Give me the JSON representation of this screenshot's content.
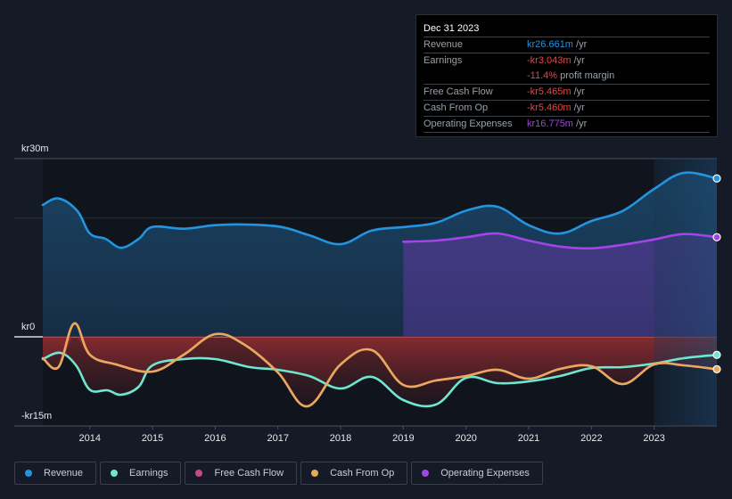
{
  "tooltip": {
    "date": "Dec 31 2023",
    "rows": [
      {
        "label": "Revenue",
        "value": "kr26.661m",
        "unit": " /yr",
        "color": "#2394df"
      },
      {
        "label": "Earnings",
        "value": "-kr3.043m",
        "unit": " /yr",
        "color": "#e84545"
      },
      {
        "label": "",
        "value": "-11.4%",
        "unit": " profit margin",
        "color": "#e84545"
      },
      {
        "label": "Free Cash Flow",
        "value": "-kr5.465m",
        "unit": " /yr",
        "color": "#e84545"
      },
      {
        "label": "Cash From Op",
        "value": "-kr5.460m",
        "unit": " /yr",
        "color": "#e84545"
      },
      {
        "label": "Operating Expenses",
        "value": "kr16.775m",
        "unit": " /yr",
        "color": "#a145e8"
      }
    ]
  },
  "legend": [
    {
      "label": "Revenue",
      "color": "#2394df"
    },
    {
      "label": "Earnings",
      "color": "#6ee6d0"
    },
    {
      "label": "Free Cash Flow",
      "color": "#c54a8a"
    },
    {
      "label": "Cash From Op",
      "color": "#e8a95c"
    },
    {
      "label": "Operating Expenses",
      "color": "#a145e8"
    }
  ],
  "chart_data": {
    "type": "line",
    "title": "",
    "xlabel": "",
    "ylabel": "",
    "currency": "kr",
    "y_tick_labels": [
      "kr30m",
      "kr0",
      "-kr15m"
    ],
    "ylim": [
      -15,
      30
    ],
    "xlim": [
      2013.25,
      2024.0
    ],
    "x_tick_labels": [
      "2014",
      "2015",
      "2016",
      "2017",
      "2018",
      "2019",
      "2020",
      "2021",
      "2022",
      "2023"
    ],
    "x_ticks": [
      2014,
      2015,
      2016,
      2017,
      2018,
      2019,
      2020,
      2021,
      2022,
      2023
    ],
    "gridlines": [
      30,
      20,
      0,
      -15
    ],
    "highlight_start": 2023.0,
    "series": [
      {
        "name": "Revenue",
        "color": "#2394df",
        "fill": true,
        "points": [
          [
            2013.25,
            22.2
          ],
          [
            2013.5,
            23.3
          ],
          [
            2013.8,
            21.2
          ],
          [
            2014.0,
            17.4
          ],
          [
            2014.25,
            16.5
          ],
          [
            2014.5,
            15.0
          ],
          [
            2014.78,
            16.5
          ],
          [
            2015.0,
            18.5
          ],
          [
            2015.5,
            18.2
          ],
          [
            2016.0,
            18.8
          ],
          [
            2016.5,
            18.9
          ],
          [
            2017.05,
            18.5
          ],
          [
            2017.5,
            17.1
          ],
          [
            2018.0,
            15.6
          ],
          [
            2018.5,
            17.9
          ],
          [
            2019.03,
            18.5
          ],
          [
            2019.52,
            19.2
          ],
          [
            2020.02,
            21.3
          ],
          [
            2020.5,
            21.9
          ],
          [
            2021.0,
            18.8
          ],
          [
            2021.5,
            17.4
          ],
          [
            2022.0,
            19.5
          ],
          [
            2022.5,
            21.2
          ],
          [
            2023.0,
            24.9
          ],
          [
            2023.47,
            27.6
          ],
          [
            2024.0,
            26.661
          ]
        ]
      },
      {
        "name": "Operating Expenses",
        "color": "#a145e8",
        "fill": true,
        "points": [
          [
            2019.0,
            16.0
          ],
          [
            2019.52,
            16.2
          ],
          [
            2020.02,
            16.8
          ],
          [
            2020.5,
            17.4
          ],
          [
            2021.0,
            16.2
          ],
          [
            2021.5,
            15.2
          ],
          [
            2022.0,
            14.9
          ],
          [
            2022.5,
            15.5
          ],
          [
            2023.0,
            16.4
          ],
          [
            2023.47,
            17.3
          ],
          [
            2024.0,
            16.775
          ]
        ]
      },
      {
        "name": "Earnings",
        "color": "#6ee6d0",
        "fill": false,
        "points": [
          [
            2013.25,
            -3.75
          ],
          [
            2013.53,
            -2.7
          ],
          [
            2013.78,
            -4.8
          ],
          [
            2014.0,
            -8.9
          ],
          [
            2014.28,
            -9.0
          ],
          [
            2014.5,
            -9.75
          ],
          [
            2014.78,
            -8.4
          ],
          [
            2015.0,
            -4.8
          ],
          [
            2015.5,
            -3.75
          ],
          [
            2016.0,
            -3.75
          ],
          [
            2016.55,
            -5.1
          ],
          [
            2017.0,
            -5.55
          ],
          [
            2017.5,
            -6.6
          ],
          [
            2018.0,
            -8.7
          ],
          [
            2018.5,
            -6.75
          ],
          [
            2019.0,
            -10.65
          ],
          [
            2019.52,
            -11.4
          ],
          [
            2020.0,
            -6.9
          ],
          [
            2020.5,
            -7.8
          ],
          [
            2021.0,
            -7.5
          ],
          [
            2021.5,
            -6.6
          ],
          [
            2022.0,
            -5.25
          ],
          [
            2022.5,
            -5.1
          ],
          [
            2023.0,
            -4.5
          ],
          [
            2023.47,
            -3.6
          ],
          [
            2024.0,
            -3.043
          ]
        ]
      },
      {
        "name": "Free Cash Flow",
        "color": "#c54a8a",
        "fill": false,
        "points": [
          [
            2013.25,
            -3.6
          ],
          [
            2013.5,
            -5.1
          ],
          [
            2013.75,
            2.25
          ],
          [
            2014.0,
            -3.0
          ],
          [
            2014.42,
            -4.65
          ],
          [
            2015.0,
            -5.85
          ],
          [
            2015.5,
            -3.0
          ],
          [
            2016.0,
            0.45
          ],
          [
            2016.47,
            -1.35
          ],
          [
            2017.0,
            -6.0
          ],
          [
            2017.47,
            -11.7
          ],
          [
            2018.0,
            -4.65
          ],
          [
            2018.5,
            -2.25
          ],
          [
            2019.0,
            -8.1
          ],
          [
            2019.52,
            -7.35
          ],
          [
            2020.0,
            -6.6
          ],
          [
            2020.5,
            -5.55
          ],
          [
            2021.0,
            -7.05
          ],
          [
            2021.5,
            -5.4
          ],
          [
            2022.0,
            -4.95
          ],
          [
            2022.5,
            -7.95
          ],
          [
            2023.0,
            -4.65
          ],
          [
            2023.47,
            -4.8
          ],
          [
            2024.0,
            -5.465
          ]
        ]
      },
      {
        "name": "Cash From Op",
        "color": "#e8a95c",
        "fill": false,
        "points": [
          [
            2013.25,
            -3.6
          ],
          [
            2013.5,
            -5.1
          ],
          [
            2013.75,
            2.25
          ],
          [
            2014.0,
            -3.0
          ],
          [
            2014.42,
            -4.65
          ],
          [
            2015.0,
            -5.85
          ],
          [
            2015.5,
            -3.0
          ],
          [
            2016.0,
            0.45
          ],
          [
            2016.47,
            -1.35
          ],
          [
            2017.0,
            -6.0
          ],
          [
            2017.47,
            -11.7
          ],
          [
            2018.0,
            -4.65
          ],
          [
            2018.5,
            -2.25
          ],
          [
            2019.0,
            -8.1
          ],
          [
            2019.52,
            -7.35
          ],
          [
            2020.0,
            -6.6
          ],
          [
            2020.5,
            -5.55
          ],
          [
            2021.0,
            -7.05
          ],
          [
            2021.5,
            -5.4
          ],
          [
            2022.0,
            -4.95
          ],
          [
            2022.5,
            -7.95
          ],
          [
            2023.0,
            -4.65
          ],
          [
            2023.47,
            -4.8
          ],
          [
            2024.0,
            -5.46
          ]
        ]
      }
    ]
  }
}
